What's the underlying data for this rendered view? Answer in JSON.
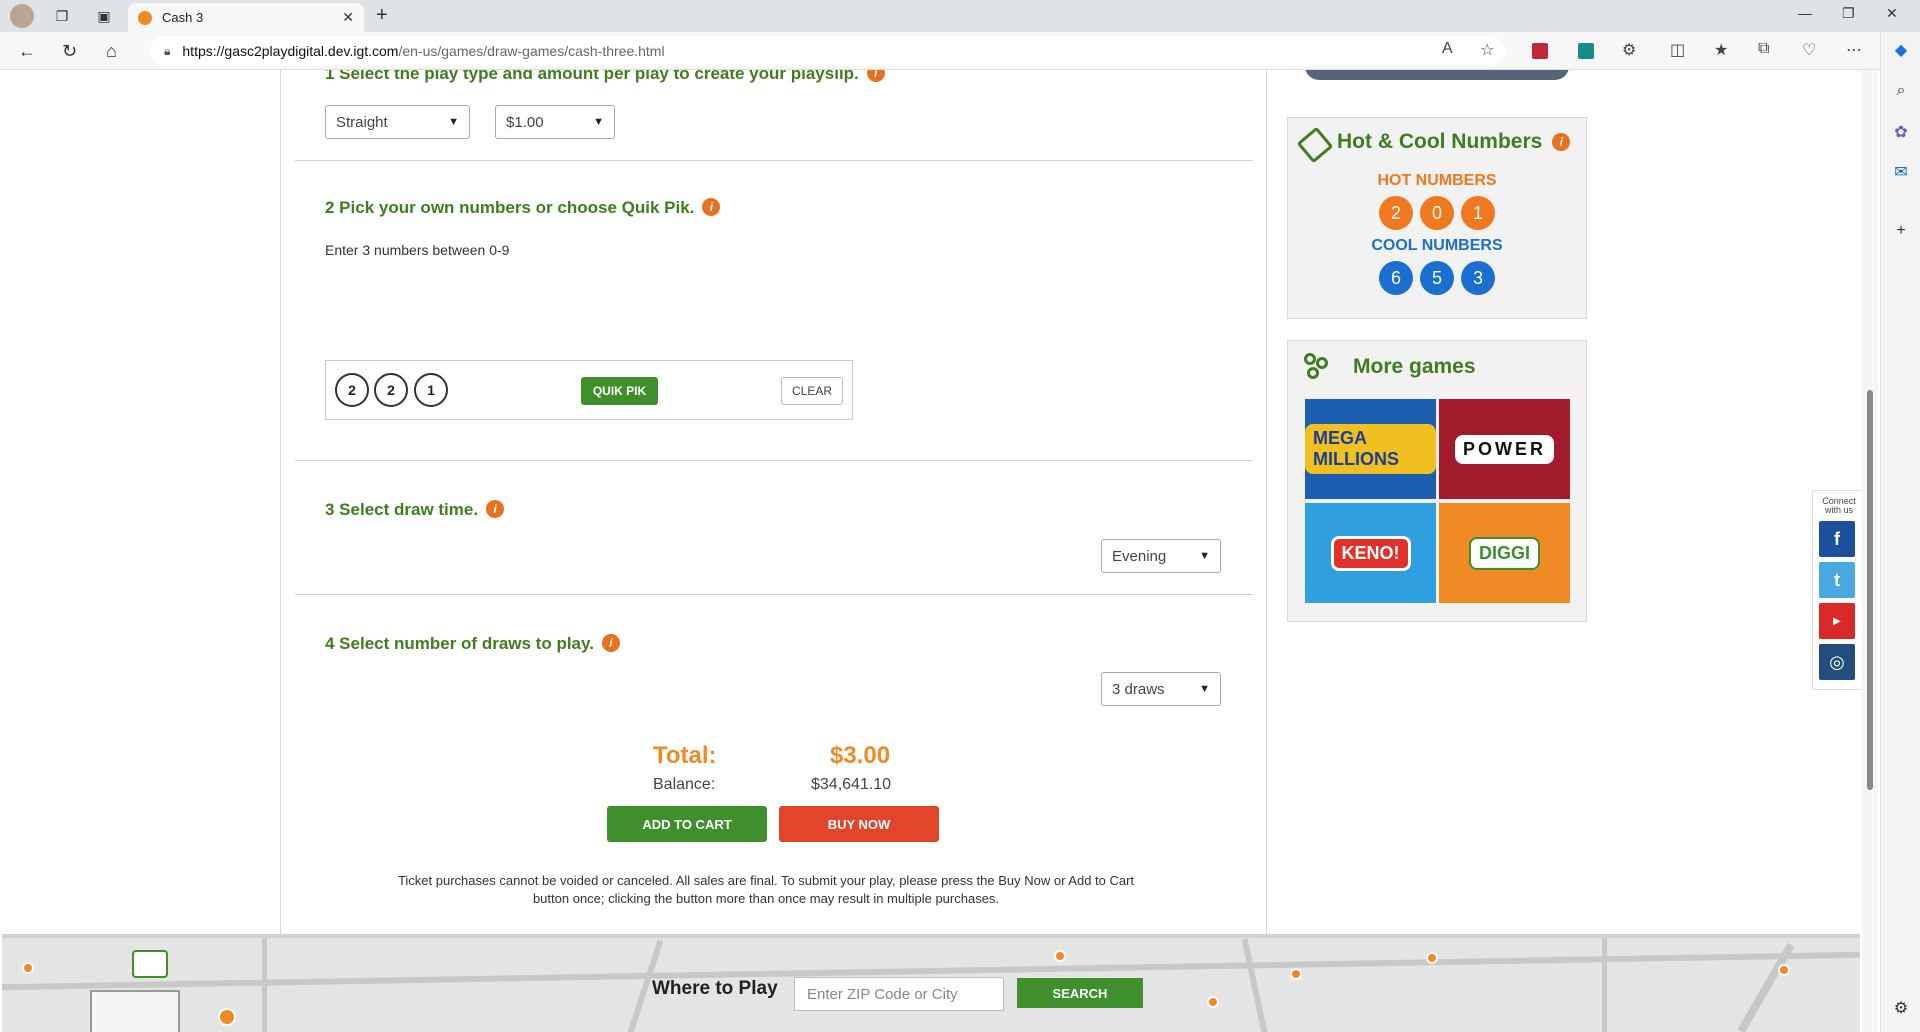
{
  "browser": {
    "tab_title": "Cash 3",
    "url_host": "https://gasc2playdigital.dev.igt.com",
    "url_path": "/en-us/games/draw-games/cash-three.html"
  },
  "step1": {
    "title": "1 Select the play type and amount per play to create your playslip.",
    "play_type": "Straight",
    "amount": "$1.00"
  },
  "step2": {
    "title": "2 Pick your own numbers or choose Quik Pik.",
    "hint": "Enter 3 numbers between 0-9",
    "numbers": [
      "2",
      "2",
      "1"
    ],
    "quik_pik_label": "QUIK PIK",
    "clear_label": "CLEAR"
  },
  "step3": {
    "title": "3 Select draw time.",
    "draw_time": "Evening"
  },
  "step4": {
    "title": "4 Select number of draws to play.",
    "draws": "3 draws"
  },
  "summary": {
    "total_label": "Total:",
    "total_value": "$3.00",
    "balance_label": "Balance:",
    "balance_value": "$34,641.10",
    "add_to_cart_label": "ADD TO CART",
    "buy_now_label": "BUY NOW",
    "disclaimer": "Ticket purchases cannot be voided or canceled. All sales are final. To submit your play, please press the Buy Now or Add to Cart button once; clicking the button more than once may result in multiple purchases."
  },
  "hot_cool": {
    "title": "Hot & Cool Numbers",
    "hot_label": "HOT NUMBERS",
    "hot_numbers": [
      "2",
      "0",
      "1"
    ],
    "cool_label": "COOL NUMBERS",
    "cool_numbers": [
      "6",
      "5",
      "3"
    ]
  },
  "more_games": {
    "title": "More games",
    "games": [
      {
        "name": "MEGA MILLIONS",
        "color": "#1c5fb0"
      },
      {
        "name": "POWER",
        "color": "#a21b2b"
      },
      {
        "name": "KENO!",
        "color": "#2f9fe0"
      },
      {
        "name": "DIGGI",
        "color": "#f08a24"
      }
    ]
  },
  "connect": {
    "label": "Connect with us",
    "networks": [
      "facebook",
      "twitter",
      "youtube",
      "instagram"
    ]
  },
  "footer": {
    "where_to_play": "Where to Play",
    "zip_placeholder": "Enter ZIP Code or City",
    "search_label": "SEARCH"
  },
  "colors": {
    "brand_green": "#3f7d1f",
    "button_green": "#3f8f2c",
    "accent_orange": "#f08a24",
    "buy_red": "#e2462a",
    "cool_blue": "#1a6fd1"
  }
}
